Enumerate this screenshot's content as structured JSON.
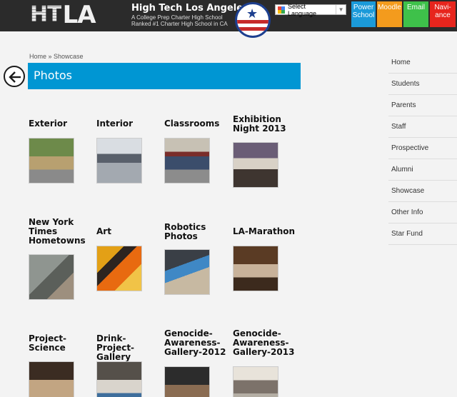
{
  "header": {
    "logo_ht": "HT",
    "logo_la": "LA",
    "school_name": "High Tech Los Angeles",
    "tagline_1": "A College Prep Charter High School",
    "tagline_2": "Ranked #1 Charter High School in CA",
    "translate_label": "Select Language",
    "buttons": {
      "power": [
        "Power",
        "School"
      ],
      "moodle": "Moodle",
      "email": "Email",
      "navi": [
        "Navi-",
        "ance"
      ]
    },
    "colors": {
      "power": "#1b9ad9",
      "moodle": "#f39b1d",
      "email": "#3ec14a",
      "navi": "#e7251d"
    }
  },
  "breadcrumb": {
    "home": "Home",
    "sep": " » ",
    "current": "Showcase"
  },
  "page_title": "Photos",
  "gallery": [
    {
      "lines": [
        "Exterior"
      ]
    },
    {
      "lines": [
        "Interior"
      ]
    },
    {
      "lines": [
        "Classrooms"
      ]
    },
    {
      "lines": [
        "Exhibition",
        "Night 2013"
      ]
    },
    {
      "lines": [
        "New York",
        "Times",
        "Hometowns"
      ]
    },
    {
      "lines": [
        "Art"
      ]
    },
    {
      "lines": [
        "Robotics",
        "Photos"
      ]
    },
    {
      "lines": [
        "LA-Marathon"
      ]
    },
    {
      "lines": [
        "Project-",
        "Science"
      ]
    },
    {
      "lines": [
        "Drink-Project-",
        "Gallery"
      ]
    },
    {
      "lines": [
        "Genocide-",
        "Awareness-",
        "Gallery-2012"
      ]
    },
    {
      "lines": [
        "Genocide-",
        "Awareness-",
        "Gallery-2013"
      ]
    }
  ],
  "sidenav": [
    "Home",
    "Students",
    "Parents",
    "Staff",
    "Prospective",
    "Alumni",
    "Showcase",
    "Other Info",
    "Star Fund"
  ]
}
